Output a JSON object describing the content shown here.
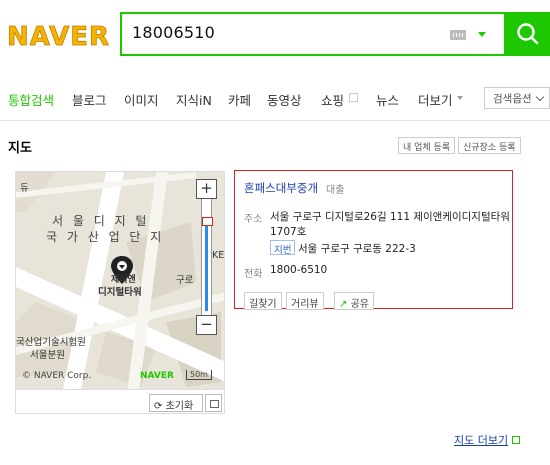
{
  "header": {
    "logo_text": "NAVER",
    "search_value": "18006510",
    "accent_color": "#1ec800"
  },
  "tabs": {
    "items": [
      "통합검색",
      "블로그",
      "이미지",
      "지식iN",
      "카페",
      "동영상",
      "쇼핑",
      "뉴스",
      "더보기"
    ],
    "active": "통합검색",
    "options_label": "검색옵션"
  },
  "map_section": {
    "title": "지도",
    "register_label": "내 업체 등록",
    "new_place_label": "신규장소 등록",
    "more_label": "지도 더보기"
  },
  "map": {
    "label_district_1": "서 울 디 지 털",
    "label_district_2": "국 가 산 업 단 지",
    "label_tower_1": "제이앤",
    "label_tower_2": "디지털타워",
    "label_guro": "구로",
    "label_institute_1": "국산업기술시험원",
    "label_institute_2": "서울분원",
    "label_edge_1": "듀",
    "label_edge_2": "KE",
    "copyright": "© NAVER Corp.",
    "brand": "NAVER",
    "scale": "50m",
    "zoom_in": "+",
    "zoom_out": "−",
    "reset_label": "초기화"
  },
  "place": {
    "name": "혼패스대부중개",
    "category": "대출",
    "address_label": "주소",
    "address_line1": "서울 구로구 디지털로26길 111 제이앤케이디지털타워",
    "address_line2": "1707호",
    "jibun_badge": "지번",
    "jibun_address": "서울 구로구 구로동 222-3",
    "phone_label": "전화",
    "phone": "1800-6510",
    "buttons": {
      "directions": "길찾기",
      "street_view": "거리뷰",
      "share": "공유"
    }
  }
}
